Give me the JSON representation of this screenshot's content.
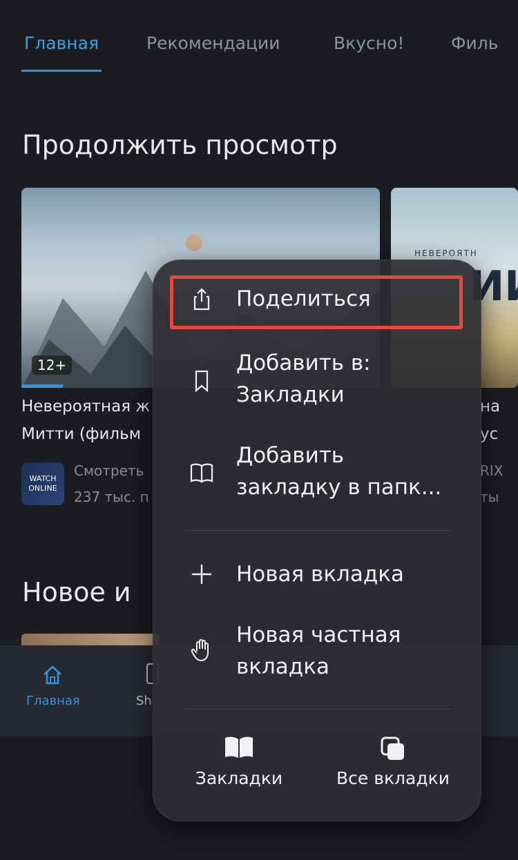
{
  "tabs": [
    {
      "label": "Главная",
      "active": true
    },
    {
      "label": "Рекомендации"
    },
    {
      "label": "Вкусно!"
    },
    {
      "label": "Филь"
    }
  ],
  "continue_section": {
    "title": "Продолжить просмотр",
    "card1": {
      "age_rating": "12+",
      "title_line1": "Невероятная ж",
      "title_line2": "Митти (фильм",
      "channel_logo_text": "WATCH ONLINE",
      "meta_line1": "Смотреть",
      "meta_line2": "237 тыс. п"
    },
    "card2": {
      "poster_small": "НЕВЕРОЯТН",
      "poster_big": "ИИ",
      "title_line1": "на",
      "title_line2": "ус",
      "meta_line1": "RIX",
      "meta_line2": "ты"
    }
  },
  "new_section": {
    "title": "Новое и"
  },
  "bottom_nav": {
    "home_label": "Главная",
    "second_label": "Sh"
  },
  "context_menu": {
    "share": "Поделиться",
    "add_to_line1": "Добавить в:",
    "add_to_line2": "Закладки",
    "add_folder_line1": "Добавить",
    "add_folder_line2": "закладку в папк...",
    "new_tab": "Новая вкладка",
    "private_tab_line1": "Новая частная",
    "private_tab_line2": "вкладка",
    "bookmarks_button": "Закладки",
    "all_tabs_button": "Все вкладки"
  },
  "colors": {
    "accent": "#2f97e2",
    "highlight": "#e8473b",
    "background": "#1b1c20"
  }
}
